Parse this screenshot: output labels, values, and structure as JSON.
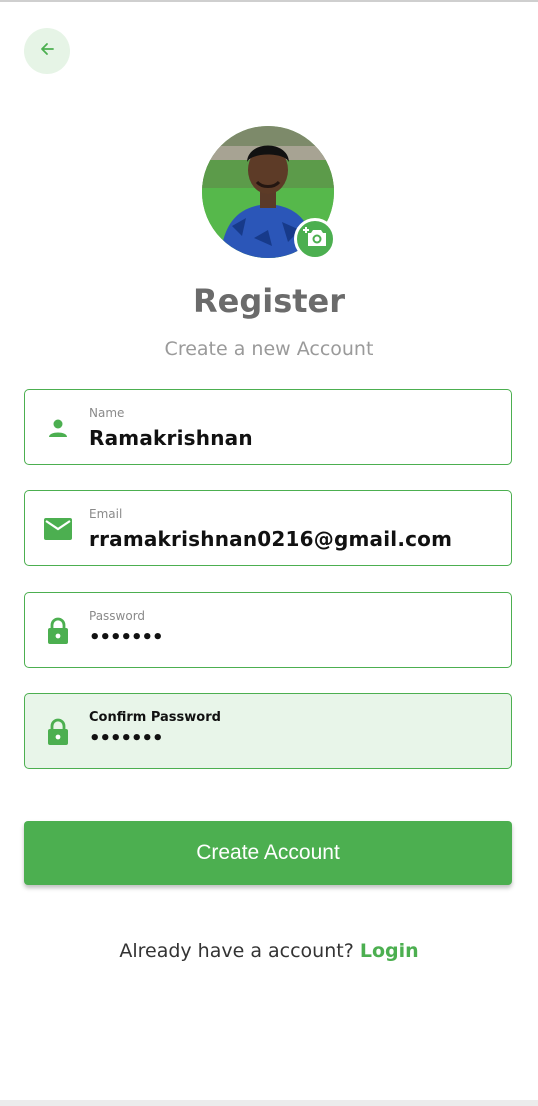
{
  "header": {
    "back_icon": "arrow-left-icon"
  },
  "profile": {
    "camera_icon": "add-photo-icon"
  },
  "title": "Register",
  "subtitle": "Create a new Account",
  "form": {
    "name": {
      "label": "Name",
      "value": "Ramakrishnan",
      "icon": "person-icon"
    },
    "email": {
      "label": "Email",
      "value": "rramakrishnan0216@gmail.com",
      "icon": "mail-icon"
    },
    "password": {
      "label": "Password",
      "value": "•••••••",
      "icon": "lock-icon"
    },
    "confirm_password": {
      "label": "Confirm Password",
      "value": "•••••••",
      "icon": "lock-icon",
      "focused": true
    }
  },
  "create_button": {
    "label": "Create Account"
  },
  "footer": {
    "prompt": "Already have a account? ",
    "login_label": "Login"
  },
  "colors": {
    "accent": "#4caf50",
    "accent_light": "#e8f5e9",
    "title": "#6b6b6b",
    "subtitle": "#9a9a9a"
  }
}
